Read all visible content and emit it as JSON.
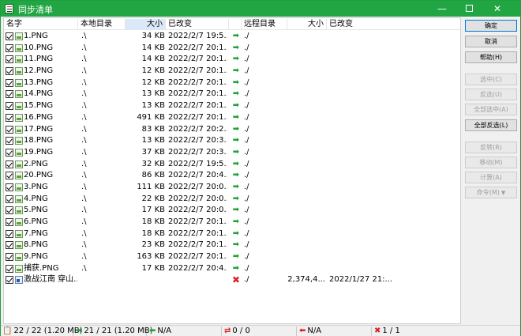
{
  "window": {
    "title": "同步清单"
  },
  "columns": {
    "name": "名字",
    "local_dir": "本地目录",
    "size": "大小",
    "modified": "已改变",
    "remote_dir": "远程目录",
    "remote_size": "大小",
    "remote_modified": "已改变"
  },
  "rows": [
    {
      "name": "1.PNG",
      "local": ".\\",
      "size": "34 KB",
      "modified": "2022/2/7 19:5...",
      "action": "sync",
      "remote": "./",
      "rsize": "",
      "rmod": "",
      "type": "image"
    },
    {
      "name": "10.PNG",
      "local": ".\\",
      "size": "14 KB",
      "modified": "2022/2/7 20:1...",
      "action": "sync",
      "remote": "./",
      "rsize": "",
      "rmod": "",
      "type": "image"
    },
    {
      "name": "11.PNG",
      "local": ".\\",
      "size": "14 KB",
      "modified": "2022/2/7 20:1...",
      "action": "sync",
      "remote": "./",
      "rsize": "",
      "rmod": "",
      "type": "image"
    },
    {
      "name": "12.PNG",
      "local": ".\\",
      "size": "12 KB",
      "modified": "2022/2/7 20:1...",
      "action": "sync",
      "remote": "./",
      "rsize": "",
      "rmod": "",
      "type": "image"
    },
    {
      "name": "13.PNG",
      "local": ".\\",
      "size": "12 KB",
      "modified": "2022/2/7 20:1...",
      "action": "sync",
      "remote": "./",
      "rsize": "",
      "rmod": "",
      "type": "image"
    },
    {
      "name": "14.PNG",
      "local": ".\\",
      "size": "13 KB",
      "modified": "2022/2/7 20:1...",
      "action": "sync",
      "remote": "./",
      "rsize": "",
      "rmod": "",
      "type": "image"
    },
    {
      "name": "15.PNG",
      "local": ".\\",
      "size": "13 KB",
      "modified": "2022/2/7 20:1...",
      "action": "sync",
      "remote": "./",
      "rsize": "",
      "rmod": "",
      "type": "image"
    },
    {
      "name": "16.PNG",
      "local": ".\\",
      "size": "491 KB",
      "modified": "2022/2/7 20:1...",
      "action": "sync",
      "remote": "./",
      "rsize": "",
      "rmod": "",
      "type": "image"
    },
    {
      "name": "17.PNG",
      "local": ".\\",
      "size": "83 KB",
      "modified": "2022/2/7 20:2...",
      "action": "sync",
      "remote": "./",
      "rsize": "",
      "rmod": "",
      "type": "image"
    },
    {
      "name": "18.PNG",
      "local": ".\\",
      "size": "13 KB",
      "modified": "2022/2/7 20:3...",
      "action": "sync",
      "remote": "./",
      "rsize": "",
      "rmod": "",
      "type": "image"
    },
    {
      "name": "19.PNG",
      "local": ".\\",
      "size": "37 KB",
      "modified": "2022/2/7 20:3...",
      "action": "sync",
      "remote": "./",
      "rsize": "",
      "rmod": "",
      "type": "image"
    },
    {
      "name": "2.PNG",
      "local": ".\\",
      "size": "32 KB",
      "modified": "2022/2/7 19:5...",
      "action": "sync",
      "remote": "./",
      "rsize": "",
      "rmod": "",
      "type": "image"
    },
    {
      "name": "20.PNG",
      "local": ".\\",
      "size": "86 KB",
      "modified": "2022/2/7 20:4...",
      "action": "sync",
      "remote": "./",
      "rsize": "",
      "rmod": "",
      "type": "image"
    },
    {
      "name": "3.PNG",
      "local": ".\\",
      "size": "111 KB",
      "modified": "2022/2/7 20:0...",
      "action": "sync",
      "remote": "./",
      "rsize": "",
      "rmod": "",
      "type": "image"
    },
    {
      "name": "4.PNG",
      "local": ".\\",
      "size": "22 KB",
      "modified": "2022/2/7 20:0...",
      "action": "sync",
      "remote": "./",
      "rsize": "",
      "rmod": "",
      "type": "image"
    },
    {
      "name": "5.PNG",
      "local": ".\\",
      "size": "17 KB",
      "modified": "2022/2/7 20:0...",
      "action": "sync",
      "remote": "./",
      "rsize": "",
      "rmod": "",
      "type": "image"
    },
    {
      "name": "6.PNG",
      "local": ".\\",
      "size": "18 KB",
      "modified": "2022/2/7 20:1...",
      "action": "sync",
      "remote": "./",
      "rsize": "",
      "rmod": "",
      "type": "image"
    },
    {
      "name": "7.PNG",
      "local": ".\\",
      "size": "18 KB",
      "modified": "2022/2/7 20:1...",
      "action": "sync",
      "remote": "./",
      "rsize": "",
      "rmod": "",
      "type": "image"
    },
    {
      "name": "8.PNG",
      "local": ".\\",
      "size": "23 KB",
      "modified": "2022/2/7 20:1...",
      "action": "sync",
      "remote": "./",
      "rsize": "",
      "rmod": "",
      "type": "image"
    },
    {
      "name": "9.PNG",
      "local": ".\\",
      "size": "163 KB",
      "modified": "2022/2/7 20:1...",
      "action": "sync",
      "remote": "./",
      "rsize": "",
      "rmod": "",
      "type": "image"
    },
    {
      "name": "捕获.PNG",
      "local": ".\\",
      "size": "17 KB",
      "modified": "2022/2/7 20:4...",
      "action": "sync",
      "remote": "./",
      "rsize": "",
      "rmod": "",
      "type": "image"
    },
    {
      "name": "激战江南 穿山...",
      "local": "",
      "size": "",
      "modified": "",
      "action": "delete",
      "remote": "./",
      "rsize": "2,374,4...",
      "rmod": "2022/1/27 21:...",
      "type": "video"
    }
  ],
  "icons": {
    "sync": "➡",
    "delete": "✖"
  },
  "buttons": {
    "ok": "确定",
    "cancel": "取消",
    "help": "帮助(H)",
    "check": "选中(C)",
    "uncheck": "反选(U)",
    "check_all": "全部选中(A)",
    "uncheck_all": "全部反选(L)",
    "reverse": "反转(R)",
    "move": "移动(M)",
    "calc": "计算(A)",
    "command": "命令(M)"
  },
  "status": {
    "total": "22 / 22 (1.20 MB)",
    "upload": "21 / 21 (1.20 MB)",
    "download": "N/A",
    "remote_changes": "0 / 0",
    "local_delete": "N/A",
    "remote_delete": "1 / 1"
  }
}
